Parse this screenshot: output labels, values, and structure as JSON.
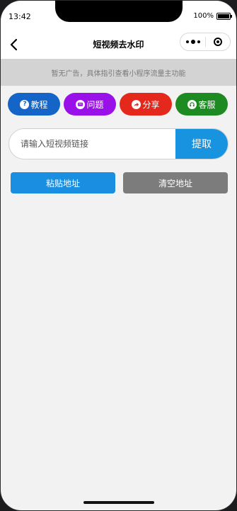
{
  "status_bar": {
    "time": "13:42",
    "battery": "100%"
  },
  "nav": {
    "title": "短视频去水印"
  },
  "notice": {
    "text": "暂无广告，具体指引查看小程序流量主功能"
  },
  "quick_buttons": [
    {
      "label": "教程",
      "icon": "question-icon",
      "color": "#1565c8"
    },
    {
      "label": "问题",
      "icon": "chat-icon",
      "color": "#9a10e8"
    },
    {
      "label": "分享",
      "icon": "share-arrow-icon",
      "color": "#e5281c"
    },
    {
      "label": "客服",
      "icon": "service-icon",
      "color": "#1e8a22"
    }
  ],
  "link_input": {
    "placeholder": "请输入短视频链接",
    "value": ""
  },
  "extract_button": {
    "label": "提取"
  },
  "actions": {
    "paste_label": "粘贴地址",
    "clear_label": "清空地址"
  }
}
